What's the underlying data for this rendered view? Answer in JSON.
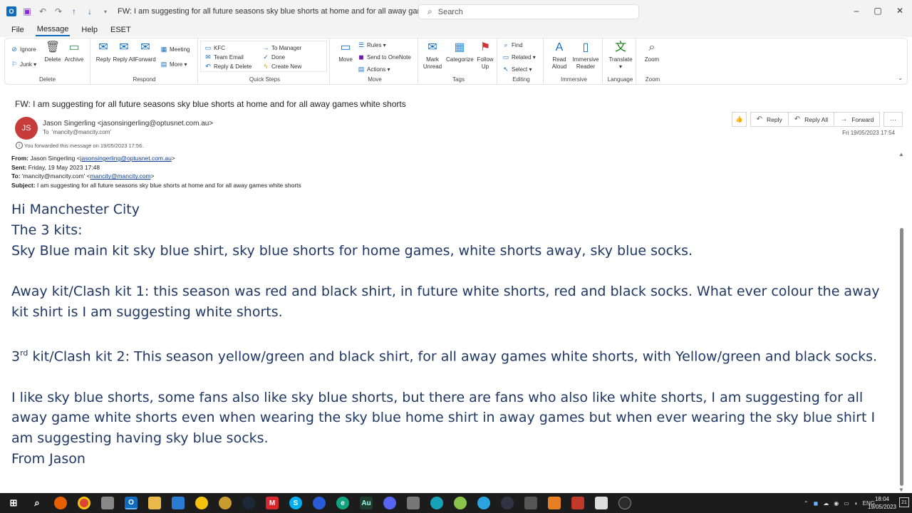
{
  "window": {
    "title": "FW: I am suggesting for all future seasons sky blue shorts at home and for all away games white shorts  -  Message (HT...",
    "search_placeholder": "Search",
    "app_icon": "O"
  },
  "menu": [
    "File",
    "Message",
    "Help",
    "ESET"
  ],
  "ribbon": {
    "delete": {
      "label": "Delete",
      "ignore": "Ignore",
      "junk": "Junk",
      "delete": "Delete",
      "archive": "Archive"
    },
    "respond": {
      "label": "Respond",
      "reply": "Reply",
      "reply_all": "Reply All",
      "forward": "Forward",
      "meeting": "Meeting",
      "more": "More"
    },
    "quick_steps": {
      "label": "Quick Steps",
      "items": [
        "KFC",
        "Team Email",
        "Reply & Delete",
        "To Manager",
        "Done",
        "Create New"
      ]
    },
    "move": {
      "label": "Move",
      "move": "Move",
      "rules": "Rules",
      "onenote": "Send to OneNote",
      "actions": "Actions"
    },
    "tags": {
      "label": "Tags",
      "mark_unread": "Mark Unread",
      "categorize": "Categorize",
      "follow_up": "Follow Up"
    },
    "editing": {
      "label": "Editing",
      "find": "Find",
      "related": "Related",
      "select": "Select"
    },
    "immersive": {
      "label": "Immersive",
      "read_aloud": "Read Aloud",
      "immersive_reader": "Immersive Reader"
    },
    "language": {
      "label": "Language",
      "translate": "Translate"
    },
    "zoom": {
      "label": "Zoom",
      "zoom": "Zoom"
    }
  },
  "message": {
    "subject": "FW: I am suggesting for all future seasons sky blue shorts at home and for all away games white shorts",
    "avatar_initials": "JS",
    "sender": "Jason Singerling <jasonsingerling@optusnet.com.au>",
    "to_label": "To",
    "to": "'mancity@mancity.com'",
    "forwarded_note": "You forwarded this message on 19/05/2023 17:56.",
    "datetime": "Fri 19/05/2023 17:54",
    "actions": {
      "reply": "Reply",
      "reply_all": "Reply All",
      "forward": "Forward",
      "more": "···"
    }
  },
  "forwarded_headers": {
    "from_label": "From:",
    "from_name": "Jason Singerling <",
    "from_email": "jasonsingerling@optusnet.com.au",
    "from_close": ">",
    "sent_label": "Sent:",
    "sent": "Friday, 19 May 2023 17:48",
    "to_label": "To:",
    "to_name": "'mancity@mancity.com' <",
    "to_email": "mancity@mancity.com",
    "to_close": ">",
    "subject_label": "Subject:",
    "subject": "I am suggesting for all future seasons sky blue shorts at home and for all away games white shorts"
  },
  "body": {
    "greeting": "Hi Manchester City",
    "kits_intro": "The 3 kits:",
    "kit1": "Sky Blue main kit sky blue shirt, sky blue shorts for home games, white shorts away, sky blue socks.",
    "kit2": "Away kit/Clash kit 1: this season was red and black shirt, in future white shorts, red and black socks. What ever colour the away kit shirt is I am suggesting white shorts.",
    "kit3_num": "3",
    "kit3_sup": "rd",
    "kit3": " kit/Clash kit 2: This season yellow/green and black shirt, for all away games white shorts, with Yellow/green and black socks.",
    "closing": "I like sky blue shorts, some fans also like sky blue shorts, but there are fans who also like white shorts, I am suggesting for all away game white shorts even when wearing the sky blue home shirt in away games but when ever wearing the sky blue shirt I am suggesting having sky blue socks.",
    "signoff": "From Jason"
  },
  "taskbar": {
    "icons": [
      "windows-start",
      "search",
      "firefox",
      "chrome",
      "media",
      "outlook",
      "file-explorer",
      "app-blue",
      "app-yellow",
      "app-gold",
      "steam",
      "mega",
      "skype",
      "bluetooth",
      "edge",
      "audition",
      "discord",
      "app-grey",
      "app-teal",
      "app-green",
      "telegram",
      "app-dark",
      "app-settings",
      "app-slides",
      "app-red",
      "app-notes",
      "app-active"
    ],
    "tray_lang": "ENG",
    "time": "18:04",
    "date": "19/05/2023",
    "notifications": "21"
  }
}
